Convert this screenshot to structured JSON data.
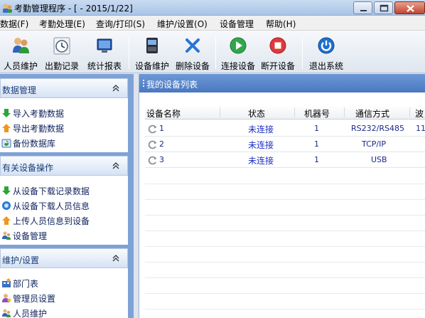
{
  "window": {
    "title": "考勤管理程序 - [ - 2015/1/22]"
  },
  "menu": [
    {
      "label": "数据(F)"
    },
    {
      "label": "考勤处理(E)"
    },
    {
      "label": "查询/打印(S)"
    },
    {
      "label": "维护/设置(O)"
    },
    {
      "label": "设备管理"
    },
    {
      "label": "帮助(H)"
    }
  ],
  "toolbar": [
    {
      "label": "人员维护",
      "icon": "people-icon"
    },
    {
      "label": "出勤记录",
      "icon": "clock-icon"
    },
    {
      "label": "统计报表",
      "icon": "monitor-icon"
    },
    {
      "label": "设备维护",
      "icon": "device-icon"
    },
    {
      "label": "删除设备",
      "icon": "delete-x-icon"
    },
    {
      "label": "连接设备",
      "icon": "play-icon"
    },
    {
      "label": "断开设备",
      "icon": "stop-icon"
    },
    {
      "label": "退出系统",
      "icon": "power-icon"
    }
  ],
  "sidebar": {
    "sections": [
      {
        "title": "数据管理",
        "items": [
          {
            "label": "导入考勤数据",
            "icon": "green-arrow-down-icon"
          },
          {
            "label": "导出考勤数据",
            "icon": "orange-arrow-icon"
          },
          {
            "label": "备份数据库",
            "icon": "backup-icon"
          }
        ]
      },
      {
        "title": "有关设备操作",
        "items": [
          {
            "label": "从设备下载记录数据",
            "icon": "green-arrow-down-icon"
          },
          {
            "label": "从设备下载人员信息",
            "icon": "blue-circle-icon"
          },
          {
            "label": "上传人员信息到设备",
            "icon": "orange-arrow-icon"
          },
          {
            "label": "设备管理",
            "icon": "people-icon"
          }
        ]
      },
      {
        "title": "维护/设置",
        "items": [
          {
            "label": "部门表",
            "icon": "department-icon"
          },
          {
            "label": "管理员设置",
            "icon": "admin-icon"
          },
          {
            "label": "人员维护",
            "icon": "people-icon"
          }
        ]
      }
    ]
  },
  "device_list": {
    "title": "我的设备列表",
    "columns": [
      "设备名称",
      "状态",
      "机器号",
      "通信方式",
      "波"
    ],
    "rows": [
      {
        "name": "1",
        "status": "未连接",
        "machine_no": "1",
        "comm": "RS232/RS485",
        "baud": "11"
      },
      {
        "name": "2",
        "status": "未连接",
        "machine_no": "1",
        "comm": "TCP/IP",
        "baud": ""
      },
      {
        "name": "3",
        "status": "未连接",
        "machine_no": "1",
        "comm": "USB",
        "baud": ""
      }
    ]
  },
  "colors": {
    "sidebar_bg": "#7fa2d6",
    "panel_header": "#5a86c9",
    "status_text": "#1d2fc4"
  }
}
